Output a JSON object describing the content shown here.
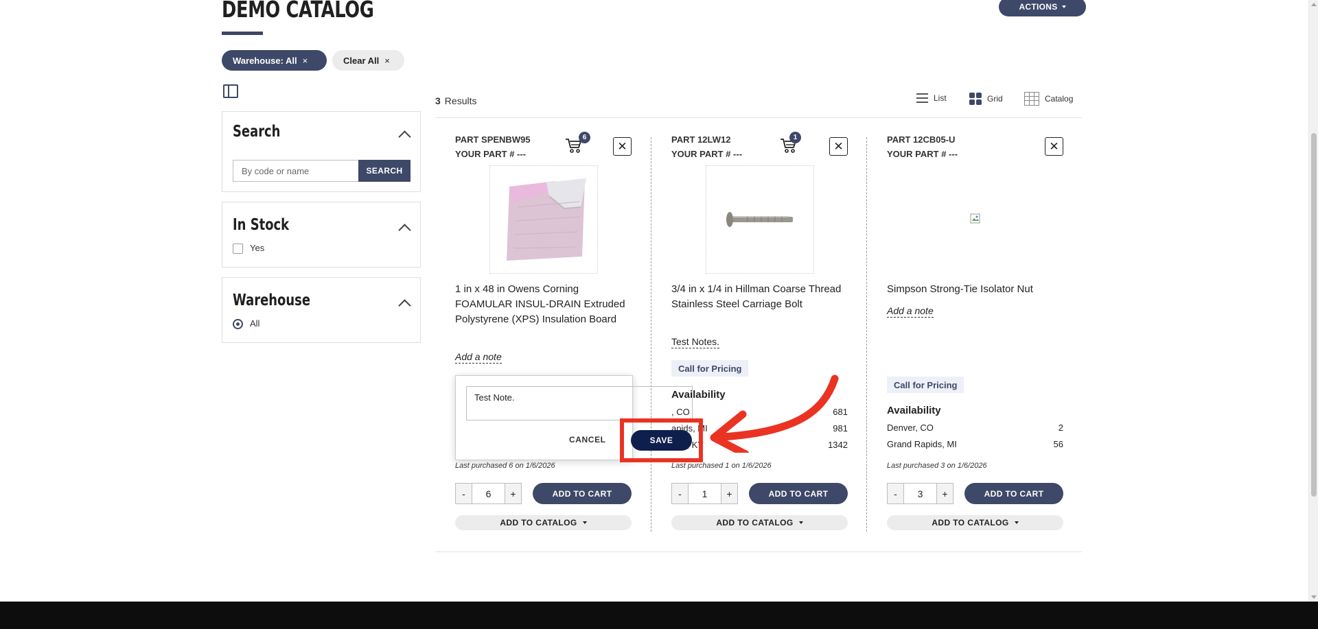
{
  "page": {
    "title": "DEMO CATALOG",
    "actions_label": "ACTIONS"
  },
  "filters": {
    "chips": [
      {
        "label": "Warehouse: All",
        "close": "×"
      },
      {
        "label": "Clear All",
        "close": "×"
      }
    ]
  },
  "sidebar": {
    "search": {
      "title": "Search",
      "placeholder": "By code or name",
      "button": "SEARCH"
    },
    "in_stock": {
      "title": "In Stock",
      "option": "Yes",
      "checked": false
    },
    "warehouse": {
      "title": "Warehouse",
      "option": "All",
      "selected": true
    }
  },
  "results": {
    "count": "3",
    "label": "Results",
    "views": [
      "List",
      "Grid",
      "Catalog"
    ],
    "active_view": "Grid"
  },
  "products": [
    {
      "part": "PART SPENBW95",
      "your_part": "YOUR PART # ---",
      "cart_count": "6",
      "name": "1 in x 48 in Owens Corning FOAMULAR INSUL-DRAIN Extruded Polystyrene (XPS) Insulation Board",
      "note_link": "Add a note",
      "last_purchased": "Last purchased 6 on 1/6/2026",
      "qty": "6",
      "add_to_cart": "ADD TO CART",
      "add_to_catalog": "ADD TO CATALOG",
      "image": "insulation-board"
    },
    {
      "part": "PART 12LW12",
      "your_part": "YOUR PART # ---",
      "cart_count": "1",
      "name": "3/4 in x 1/4 in Hillman Coarse Thread Stainless Steel Carriage Bolt",
      "note": "Test Notes.",
      "pricing": "Call for Pricing",
      "availability_title": "Availability",
      "availability": [
        {
          "location": ", CO",
          "qty": "681"
        },
        {
          "location": "apids, MI",
          "qty": "981"
        },
        {
          "location": "ville, KY",
          "qty": "1342"
        }
      ],
      "last_purchased": "Last purchased 1 on 1/6/2026",
      "qty": "1",
      "add_to_cart": "ADD TO CART",
      "add_to_catalog": "ADD TO CATALOG",
      "image": "carriage-bolt"
    },
    {
      "part": "PART 12CB05-U",
      "your_part": "YOUR PART # ---",
      "name": "Simpson Strong-Tie Isolator Nut",
      "note_link": "Add a note",
      "pricing": "Call for Pricing",
      "availability_title": "Availability",
      "availability": [
        {
          "location": "Denver, CO",
          "qty": "2"
        },
        {
          "location": "Grand Rapids, MI",
          "qty": "56"
        }
      ],
      "last_purchased": "Last purchased 3 on 1/6/2026",
      "qty": "3",
      "add_to_cart": "ADD TO CART",
      "add_to_catalog": "ADD TO CATALOG",
      "image": "broken-image"
    }
  ],
  "note_popover": {
    "value": "Test Note.",
    "cancel": "CANCEL",
    "save": "SAVE"
  },
  "qty_controls": {
    "minus": "-",
    "plus": "+"
  },
  "colors": {
    "primary": "#3e4868",
    "save": "#0e1f4d",
    "annotation": "#ea3323"
  }
}
